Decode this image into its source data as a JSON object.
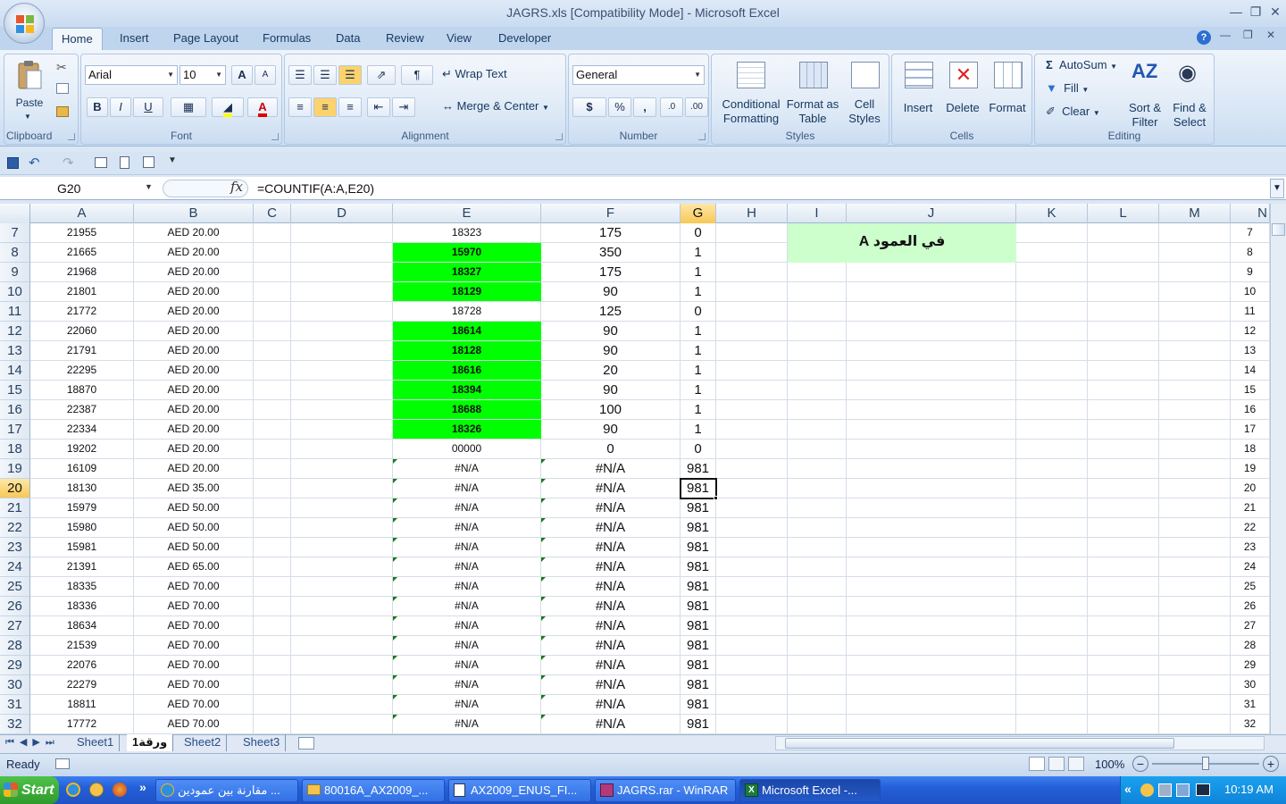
{
  "window": {
    "title": "JAGRS.xls  [Compatibility Mode] - Microsoft Excel"
  },
  "tabs": [
    "Home",
    "Insert",
    "Page Layout",
    "Formulas",
    "Data",
    "Review",
    "View",
    "Developer"
  ],
  "ribbon": {
    "clipboard": {
      "label": "Clipboard",
      "paste": "Paste"
    },
    "font": {
      "label": "Font",
      "name": "Arial",
      "size": "10",
      "bold": "B",
      "italic": "I",
      "underline": "U",
      "grow": "A",
      "shrink": "A"
    },
    "alignment": {
      "label": "Alignment",
      "wrap": "Wrap Text",
      "merge": "Merge & Center"
    },
    "number": {
      "label": "Number",
      "format": "General",
      "currency": "$",
      "percent": "%",
      "comma": ",",
      "inc": ".0",
      "dec": ".00"
    },
    "styles": {
      "label": "Styles",
      "cond1": "Conditional",
      "cond2": "Formatting",
      "fmt1": "Format as",
      "fmt2": "Table",
      "cell1": "Cell",
      "cell2": "Styles"
    },
    "cells": {
      "label": "Cells",
      "insert": "Insert",
      "delete": "Delete",
      "format": "Format"
    },
    "editing": {
      "label": "Editing",
      "autosum": "AutoSum",
      "fill": "Fill",
      "clear": "Clear",
      "sort1": "Sort &",
      "sort2": "Filter",
      "find1": "Find &",
      "find2": "Select"
    }
  },
  "namebox": "G20",
  "fx": "fx",
  "formula": "=COUNTIF(A:A,E20)",
  "columns": [
    "A",
    "B",
    "C",
    "D",
    "E",
    "F",
    "G",
    "H",
    "I",
    "J",
    "K",
    "L",
    "M",
    "N"
  ],
  "selected_column": "G",
  "selected_row": "20",
  "note_text": "في العمود A",
  "rows": [
    {
      "n": "7",
      "a": "21955",
      "b": "AED 20.00",
      "e": "18323",
      "f": "175",
      "g": "0"
    },
    {
      "n": "8",
      "a": "21665",
      "b": "AED 20.00",
      "e": "15970",
      "f": "350",
      "g": "1"
    },
    {
      "n": "9",
      "a": "21968",
      "b": "AED 20.00",
      "e": "18327",
      "f": "175",
      "g": "1"
    },
    {
      "n": "10",
      "a": "21801",
      "b": "AED 20.00",
      "e": "18129",
      "f": "90",
      "g": "1"
    },
    {
      "n": "11",
      "a": "21772",
      "b": "AED 20.00",
      "e": "18728",
      "f": "125",
      "g": "0"
    },
    {
      "n": "12",
      "a": "22060",
      "b": "AED 20.00",
      "e": "18614",
      "f": "90",
      "g": "1"
    },
    {
      "n": "13",
      "a": "21791",
      "b": "AED 20.00",
      "e": "18128",
      "f": "90",
      "g": "1"
    },
    {
      "n": "14",
      "a": "22295",
      "b": "AED 20.00",
      "e": "18616",
      "f": "20",
      "g": "1"
    },
    {
      "n": "15",
      "a": "18870",
      "b": "AED 20.00",
      "e": "18394",
      "f": "90",
      "g": "1"
    },
    {
      "n": "16",
      "a": "22387",
      "b": "AED 20.00",
      "e": "18688",
      "f": "100",
      "g": "1"
    },
    {
      "n": "17",
      "a": "22334",
      "b": "AED 20.00",
      "e": "18326",
      "f": "90",
      "g": "1"
    },
    {
      "n": "18",
      "a": "19202",
      "b": "AED 20.00",
      "e": "00000",
      "f": "0",
      "g": "0"
    },
    {
      "n": "19",
      "a": "16109",
      "b": "AED 20.00",
      "e": "#N/A",
      "f": "#N/A",
      "g": "981"
    },
    {
      "n": "20",
      "a": "18130",
      "b": "AED 35.00",
      "e": "#N/A",
      "f": "#N/A",
      "g": "981"
    },
    {
      "n": "21",
      "a": "15979",
      "b": "AED 50.00",
      "e": "#N/A",
      "f": "#N/A",
      "g": "981"
    },
    {
      "n": "22",
      "a": "15980",
      "b": "AED 50.00",
      "e": "#N/A",
      "f": "#N/A",
      "g": "981"
    },
    {
      "n": "23",
      "a": "15981",
      "b": "AED 50.00",
      "e": "#N/A",
      "f": "#N/A",
      "g": "981"
    },
    {
      "n": "24",
      "a": "21391",
      "b": "AED 65.00",
      "e": "#N/A",
      "f": "#N/A",
      "g": "981"
    },
    {
      "n": "25",
      "a": "18335",
      "b": "AED 70.00",
      "e": "#N/A",
      "f": "#N/A",
      "g": "981"
    },
    {
      "n": "26",
      "a": "18336",
      "b": "AED 70.00",
      "e": "#N/A",
      "f": "#N/A",
      "g": "981"
    },
    {
      "n": "27",
      "a": "18634",
      "b": "AED 70.00",
      "e": "#N/A",
      "f": "#N/A",
      "g": "981"
    },
    {
      "n": "28",
      "a": "21539",
      "b": "AED 70.00",
      "e": "#N/A",
      "f": "#N/A",
      "g": "981"
    },
    {
      "n": "29",
      "a": "22076",
      "b": "AED 70.00",
      "e": "#N/A",
      "f": "#N/A",
      "g": "981"
    },
    {
      "n": "30",
      "a": "22279",
      "b": "AED 70.00",
      "e": "#N/A",
      "f": "#N/A",
      "g": "981"
    },
    {
      "n": "31",
      "a": "18811",
      "b": "AED 70.00",
      "e": "#N/A",
      "f": "#N/A",
      "g": "981"
    },
    {
      "n": "32",
      "a": "17772",
      "b": "AED 70.00",
      "e": "#N/A",
      "f": "#N/A",
      "g": "981"
    }
  ],
  "green_rows": [
    "8",
    "9",
    "10",
    "12",
    "13",
    "14",
    "15",
    "16",
    "17"
  ],
  "sheets": [
    "Sheet1",
    "ورقة1",
    "Sheet2",
    "Sheet3"
  ],
  "active_sheet": "ورقة1",
  "status": {
    "ready": "Ready",
    "zoom": "100%"
  },
  "taskbar": {
    "start": "Start",
    "more": "»",
    "tasks": [
      "مقارنة بين عمودين ...",
      "80016A_AX2009_...",
      "AX2009_ENUS_FI...",
      "JAGRS.rar - WinRAR",
      "Microsoft Excel -..."
    ],
    "active_task": "Microsoft Excel -...",
    "clock": "10:19 AM",
    "tray_arrow": "«"
  },
  "colors": {
    "green_fill": "#00ff00",
    "note_fill": "#ccffcc",
    "selection": "#f8c855"
  }
}
